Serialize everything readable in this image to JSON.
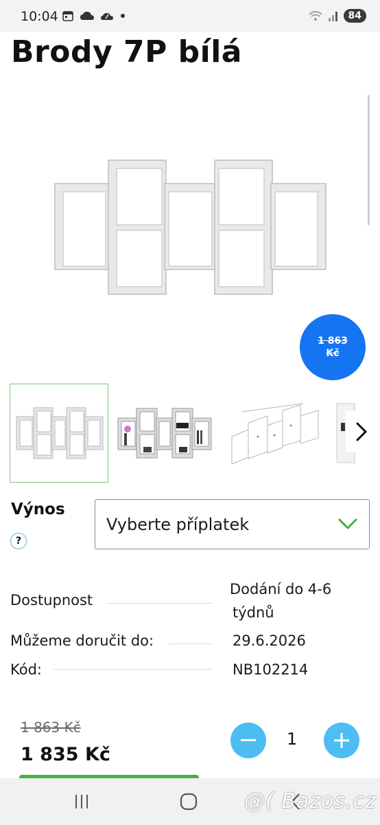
{
  "status_bar": {
    "time": "10:04",
    "battery": "84",
    "icons_left": [
      "calendar-icon",
      "cloud-icon",
      "weather-icon"
    ],
    "icons_right": [
      "wifi-icon",
      "signal-icon"
    ]
  },
  "product": {
    "title": "Brody 7P bílá",
    "badge_price_line1": "1 863",
    "badge_price_line2": "Kč",
    "gallery": {
      "thumbnails": [
        "shelf-white-thumbnail",
        "shelf-decorated-thumbnail",
        "shelf-dimensions-thumbnail",
        "shelf-detail-thumbnail"
      ],
      "next_icon": "chevron-right-icon"
    }
  },
  "surcharge": {
    "label": "Výnos",
    "help": "?",
    "select_value": "Vyberte příplatek",
    "chevron_color": "#3cb44a"
  },
  "info": {
    "availability_label": "Dostupnost",
    "availability_value_line1": "Dodání do 4-6",
    "availability_value_line2": "týdnů",
    "delivery_label": "Můžeme doručit do:",
    "delivery_value": "29.6.2026",
    "code_label": "Kód:",
    "code_value": "NB102214"
  },
  "pricing": {
    "old_price": "1 863 Kč",
    "new_price": "1 835 Kč",
    "quantity": "1",
    "minus": "−",
    "plus": "+",
    "accent_color": "#4dbdf2",
    "badge_color": "#1574f2"
  },
  "nav": {
    "recent_icon": "recent-apps-icon",
    "home_icon": "home-icon",
    "back_icon": "back-icon"
  },
  "watermark": "@( Bazos.cz"
}
